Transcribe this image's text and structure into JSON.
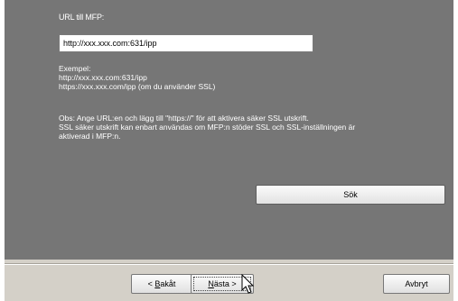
{
  "form": {
    "url_label": "URL till MFP:",
    "url_value": "http://xxx.xxx.com:631/ipp",
    "example_heading": "Exempel:",
    "example_http": "http://xxx.xxx.com:631/ipp",
    "example_https": "https://xxx.xxx.com/ipp (om du använder SSL)",
    "note_line1": "Obs: Ange URL:en och lägg till \"https://\" för att aktivera säker SSL utskrift.",
    "note_line2": "SSL säker utskrift kan enbart användas om MFP:n stöder SSL och SSL-inställningen är",
    "note_line3": "aktiverad i MFP:n.",
    "search_label": "Sök"
  },
  "footer": {
    "back_prefix": "< ",
    "back_mnemonic": "B",
    "back_rest": "akåt",
    "next_mnemonic": "N",
    "next_rest": "ästa >",
    "cancel_label": "Avbryt"
  },
  "icons": {
    "cursor": "mouse-pointer-icon"
  }
}
